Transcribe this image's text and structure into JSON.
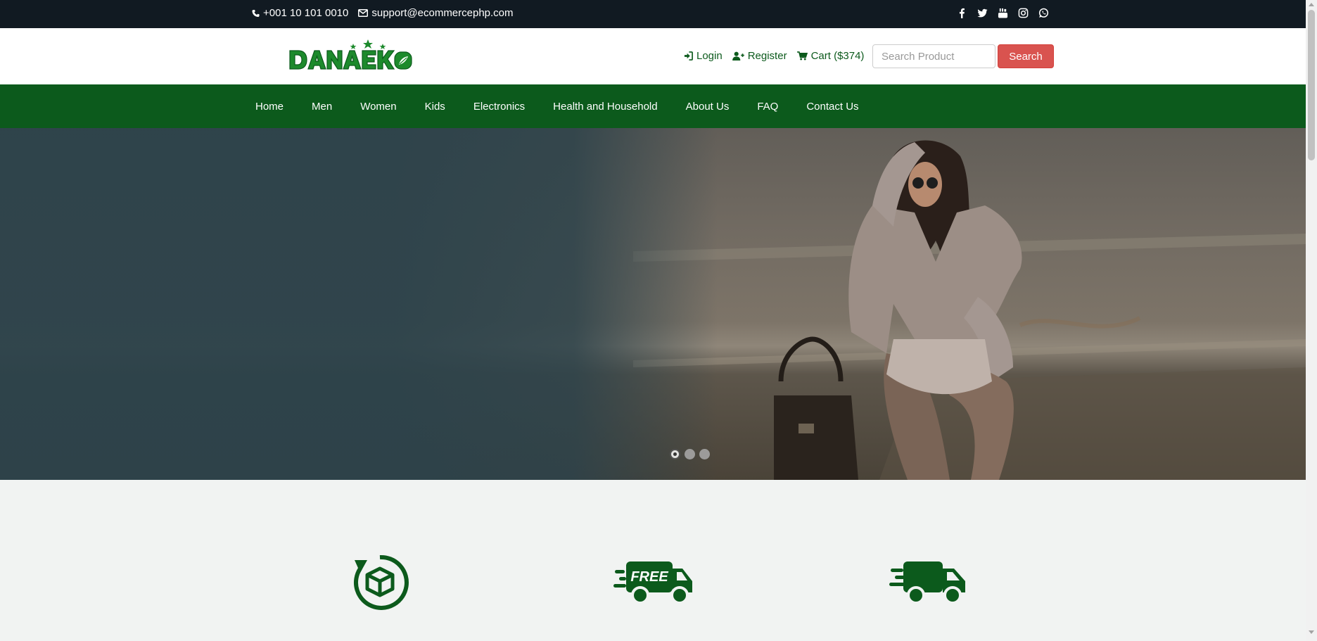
{
  "topbar": {
    "phone": "+001 10 101 0010",
    "email": "support@ecommercephp.com",
    "social": [
      "facebook-icon",
      "twitter-icon",
      "youtube-icon",
      "instagram-icon",
      "whatsapp-icon"
    ]
  },
  "header": {
    "logo_text": "DANAEKO",
    "login": "Login",
    "register": "Register",
    "cart": "Cart ($374)",
    "search_placeholder": "Search Product",
    "search_button": "Search"
  },
  "nav": {
    "items": [
      "Home",
      "Men",
      "Women",
      "Kids",
      "Electronics",
      "Health and Household",
      "About Us",
      "FAQ",
      "Contact Us"
    ]
  },
  "hero": {
    "slides_count": 3,
    "active_slide": 1
  },
  "features": {
    "icons": [
      "return-box-icon",
      "free-delivery-truck-icon",
      "fast-delivery-truck-icon"
    ],
    "free_label": "FREE"
  },
  "colors": {
    "topbar": "#111a22",
    "brand_green": "#0c5a1c",
    "search_red": "#d9534f",
    "hero_overlay": "#2c424a"
  }
}
